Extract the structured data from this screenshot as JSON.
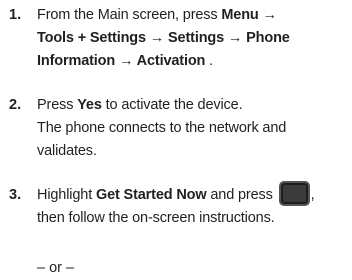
{
  "steps": [
    {
      "number": "1.",
      "line1_pre": "From the Main screen, press ",
      "menu": "Menu",
      "arrow": " →",
      "line2": "Tools + Settings → Settings → Phone",
      "line3": "Information → Activation",
      "line3_tail": " ."
    },
    {
      "number": "2.",
      "pre": "Press ",
      "yes": "Yes",
      "post": " to activate the device.",
      "line2": "The phone connects to the network and",
      "line3": "validates."
    },
    {
      "number": "3.",
      "pre": "Highlight ",
      "target": "Get Started Now",
      "mid": " and press ",
      "key_icon": "ok-key-icon",
      "comma": ",",
      "line2": "then follow the on-screen instructions."
    }
  ],
  "or_separator": "– or –"
}
